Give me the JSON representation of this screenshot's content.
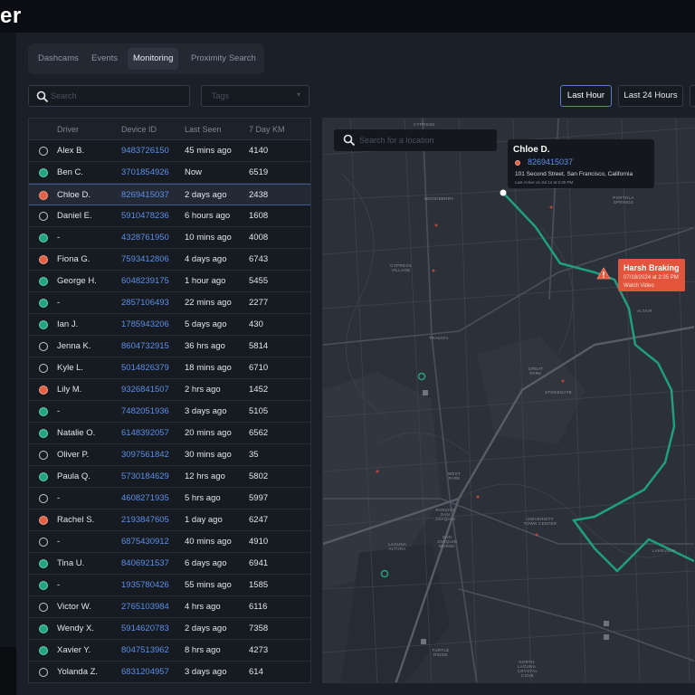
{
  "app": {
    "brand": "er"
  },
  "tabs": [
    {
      "label": "Dashcams",
      "active": false
    },
    {
      "label": "Events",
      "active": false
    },
    {
      "label": "Monitoring",
      "active": true
    },
    {
      "label": "Proximity Search",
      "active": false
    }
  ],
  "filters": {
    "search_placeholder": "Search",
    "tags_placeholder": "Tags"
  },
  "time_ranges": [
    {
      "label": "Last Hour",
      "active": true
    },
    {
      "label": "Last 24 Hours",
      "active": false
    }
  ],
  "table": {
    "columns": [
      "Driver",
      "Device ID",
      "Last Seen",
      "7 Day KM"
    ],
    "rows": [
      {
        "status": "none",
        "driver": "Alex B.",
        "device": "9483726150",
        "last_seen": "45 mins ago",
        "km": "4140"
      },
      {
        "status": "green",
        "driver": "Ben C.",
        "device": "3701854926",
        "last_seen": "Now",
        "km": "6519"
      },
      {
        "status": "red",
        "driver": "Chloe D.",
        "device": "8269415037",
        "last_seen": "2 days ago",
        "km": "2438",
        "selected": true
      },
      {
        "status": "none",
        "driver": "Daniel E.",
        "device": "5910478236",
        "last_seen": "6 hours ago",
        "km": "1608"
      },
      {
        "status": "green",
        "driver": "-",
        "device": "4328761950",
        "last_seen": "10 mins ago",
        "km": "4008"
      },
      {
        "status": "red",
        "driver": "Fiona G.",
        "device": "7593412806",
        "last_seen": "4 days ago",
        "km": "6743"
      },
      {
        "status": "green",
        "driver": "George H.",
        "device": "6048239175",
        "last_seen": "1 hour ago",
        "km": "5455"
      },
      {
        "status": "green",
        "driver": "-",
        "device": "2857106493",
        "last_seen": "22 mins ago",
        "km": "2277"
      },
      {
        "status": "green",
        "driver": "Ian J.",
        "device": "1785943206",
        "last_seen": "5 days ago",
        "km": "430"
      },
      {
        "status": "none",
        "driver": "Jenna K.",
        "device": "8604732915",
        "last_seen": "36 hrs ago",
        "km": "5814"
      },
      {
        "status": "none",
        "driver": "Kyle L.",
        "device": "5014826379",
        "last_seen": "18 mins ago",
        "km": "6710"
      },
      {
        "status": "red",
        "driver": "Lily M.",
        "device": "9326841507",
        "last_seen": "2 hrs ago",
        "km": "1452"
      },
      {
        "status": "green",
        "driver": "-",
        "device": "7482051936",
        "last_seen": "3 days ago",
        "km": "5105"
      },
      {
        "status": "green",
        "driver": "Natalie O.",
        "device": "6148392057",
        "last_seen": "20 mins ago",
        "km": "6562"
      },
      {
        "status": "none",
        "driver": "Oliver P.",
        "device": "3097561842",
        "last_seen": "30 mins ago",
        "km": "35"
      },
      {
        "status": "green",
        "driver": "Paula Q.",
        "device": "5730184629",
        "last_seen": "12 hrs ago",
        "km": "5802"
      },
      {
        "status": "none",
        "driver": "-",
        "device": "4608271935",
        "last_seen": "5 hrs ago",
        "km": "5997"
      },
      {
        "status": "red",
        "driver": "Rachel S.",
        "device": "2193847605",
        "last_seen": "1 day ago",
        "km": "6247"
      },
      {
        "status": "none",
        "driver": "-",
        "device": "6875430912",
        "last_seen": "40 mins ago",
        "km": "4910"
      },
      {
        "status": "green",
        "driver": "Tina U.",
        "device": "8406921537",
        "last_seen": "6 days ago",
        "km": "6941"
      },
      {
        "status": "green",
        "driver": "-",
        "device": "1935780426",
        "last_seen": "55 mins ago",
        "km": "1585"
      },
      {
        "status": "none",
        "driver": "Victor W.",
        "device": "2765103984",
        "last_seen": "4 hrs ago",
        "km": "6116"
      },
      {
        "status": "green",
        "driver": "Wendy X.",
        "device": "5914620783",
        "last_seen": "2 days ago",
        "km": "7358"
      },
      {
        "status": "green",
        "driver": "Xavier Y.",
        "device": "8047513962",
        "last_seen": "8 hrs ago",
        "km": "4273"
      },
      {
        "status": "none",
        "driver": "Yolanda Z.",
        "device": "6831204957",
        "last_seen": "3 days ago",
        "km": "614"
      }
    ]
  },
  "map": {
    "search_placeholder": "Search for a location",
    "popup": {
      "driver": "Chloe D.",
      "device": "8269415037",
      "address": "101 Second Street, San Francisco, California",
      "last_active": "Last Active on Jul 14 at 6:30 PM"
    },
    "alert": {
      "title": "Harsh Braking",
      "datetime": "07/18/2024 at 2:35 PM",
      "action": "Watch Video"
    },
    "labels": [
      "CYPRESS",
      "WOODBERRY",
      "PORTOLA SPRINGS",
      "CYPRESS VILLAGE",
      "ALTAIR",
      "TRAVATA",
      "GREAT PARK",
      "STONEGATE",
      "WEST PARK",
      "RANCHO SAN JOAQUIN",
      "UNIVERSITY TOWN CENTER",
      "LAGUNA ALTURA",
      "SAN JOAQUIN MARSH",
      "TURTLE RIDGE",
      "LAKEVIEW",
      "NORTH LAGUNA",
      "CRYSTAL COVE"
    ],
    "colors": {
      "route": "#1f9e80",
      "alert": "#e2553c"
    }
  },
  "colors": {
    "accent": "#5b7fc7",
    "link": "#5d8fe6",
    "status_green": "#27a37c",
    "status_red": "#e06347"
  }
}
